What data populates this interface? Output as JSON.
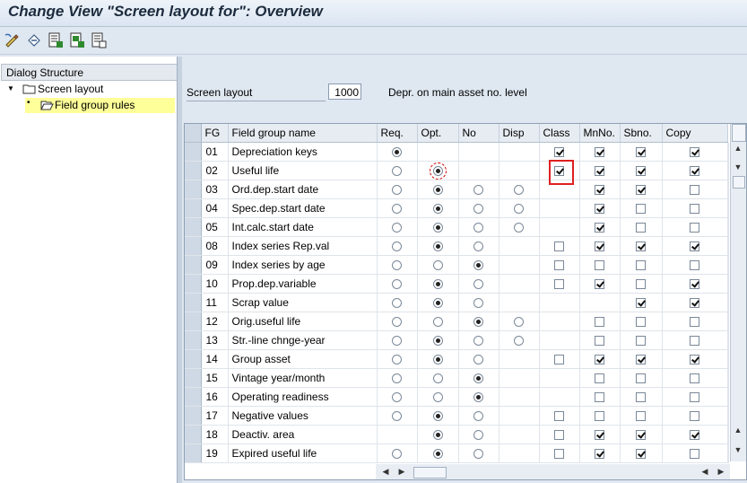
{
  "window": {
    "title": "Change View \"Screen layout for\": Overview"
  },
  "toolbar": {
    "icons": [
      "edit-icon",
      "undo-icon",
      "select-all-icon",
      "deselect-all-icon",
      "select-block-icon"
    ]
  },
  "dialog_structure": {
    "header": "Dialog Structure",
    "nodes": [
      {
        "label": "Screen layout",
        "expanded": true
      },
      {
        "label": "Field group rules",
        "selected": true
      }
    ]
  },
  "screen_layout": {
    "label": "Screen layout",
    "value": "1000",
    "description": "Depr. on main asset no. level"
  },
  "table": {
    "columns": [
      "FG",
      "Field group name",
      "Req.",
      "Opt.",
      "No",
      "Disp",
      "Class",
      "MnNo.",
      "Sbno.",
      "Copy"
    ],
    "rows": [
      {
        "fg": "01",
        "name": "Depreciation keys",
        "radios": [
          "on",
          "",
          "",
          ""
        ],
        "class": "on",
        "mnno": "on",
        "sbno": "on",
        "copy": "on"
      },
      {
        "fg": "02",
        "name": "Useful life",
        "radios": [
          "off",
          "on",
          "",
          ""
        ],
        "class": "on",
        "mnno": "on",
        "sbno": "on",
        "copy": "on"
      },
      {
        "fg": "03",
        "name": "Ord.dep.start date",
        "radios": [
          "off",
          "on",
          "off",
          "off"
        ],
        "class": "",
        "mnno": "on",
        "sbno": "on",
        "copy": "off"
      },
      {
        "fg": "04",
        "name": "Spec.dep.start date",
        "radios": [
          "off",
          "on",
          "off",
          "off"
        ],
        "class": "",
        "mnno": "on",
        "sbno": "off",
        "copy": "off"
      },
      {
        "fg": "05",
        "name": "Int.calc.start date",
        "radios": [
          "off",
          "on",
          "off",
          "off"
        ],
        "class": "",
        "mnno": "on",
        "sbno": "off",
        "copy": "off"
      },
      {
        "fg": "08",
        "name": "Index series Rep.val",
        "radios": [
          "off",
          "on",
          "off",
          ""
        ],
        "class": "off",
        "mnno": "on",
        "sbno": "on",
        "copy": "on"
      },
      {
        "fg": "09",
        "name": "Index series by age",
        "radios": [
          "off",
          "off",
          "on",
          ""
        ],
        "class": "off",
        "mnno": "off",
        "sbno": "off",
        "copy": "off"
      },
      {
        "fg": "10",
        "name": "Prop.dep.variable",
        "radios": [
          "off",
          "on",
          "off",
          ""
        ],
        "class": "off",
        "mnno": "on",
        "sbno": "off",
        "copy": "on"
      },
      {
        "fg": "11",
        "name": "Scrap value",
        "radios": [
          "off",
          "on",
          "off",
          ""
        ],
        "class": "",
        "mnno": "",
        "sbno": "on",
        "copy": "on"
      },
      {
        "fg": "12",
        "name": "Orig.useful life",
        "radios": [
          "off",
          "off",
          "on",
          "off"
        ],
        "class": "",
        "mnno": "off",
        "sbno": "off",
        "copy": "off"
      },
      {
        "fg": "13",
        "name": "Str.-line chnge-year",
        "radios": [
          "off",
          "on",
          "off",
          "off"
        ],
        "class": "",
        "mnno": "off",
        "sbno": "off",
        "copy": "off"
      },
      {
        "fg": "14",
        "name": "Group asset",
        "radios": [
          "off",
          "on",
          "off",
          ""
        ],
        "class": "off",
        "mnno": "on",
        "sbno": "on",
        "copy": "on"
      },
      {
        "fg": "15",
        "name": "Vintage year/month",
        "radios": [
          "off",
          "off",
          "on",
          ""
        ],
        "class": "",
        "mnno": "off",
        "sbno": "off",
        "copy": "off"
      },
      {
        "fg": "16",
        "name": "Operating readiness",
        "radios": [
          "off",
          "off",
          "on",
          ""
        ],
        "class": "",
        "mnno": "off",
        "sbno": "off",
        "copy": "off"
      },
      {
        "fg": "17",
        "name": "Negative values",
        "radios": [
          "off",
          "on",
          "off",
          ""
        ],
        "class": "off",
        "mnno": "off",
        "sbno": "off",
        "copy": "off"
      },
      {
        "fg": "18",
        "name": "Deactiv. area",
        "radios": [
          "",
          "on",
          "off",
          ""
        ],
        "class": "off",
        "mnno": "on",
        "sbno": "on",
        "copy": "on"
      },
      {
        "fg": "19",
        "name": "Expired useful life",
        "radios": [
          "off",
          "on",
          "off",
          ""
        ],
        "class": "off",
        "mnno": "on",
        "sbno": "on",
        "copy": "off"
      }
    ]
  },
  "colors": {
    "highlight_box": "#e02020",
    "selected_node": "#ffff99",
    "background": "#dfe7f1"
  }
}
